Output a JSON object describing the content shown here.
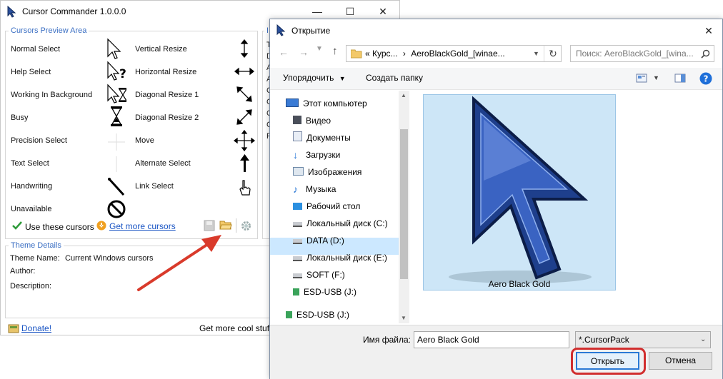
{
  "cursor_commander": {
    "title": "Cursor Commander 1.0.0.0",
    "preview_group": "Cursors Preview Area",
    "left_cursors": [
      "Normal Select",
      "Help Select",
      "Working In Background",
      "Busy",
      "Precision Select",
      "Text Select",
      "Handwriting",
      "Unavailable"
    ],
    "right_cursors": [
      "Vertical Resize",
      "Horizontal Resize",
      "Diagonal Resize 1",
      "Diagonal Resize 2",
      "Move",
      "Alternate Select",
      "Link Select"
    ],
    "use_cursors": "Use these cursors",
    "get_more": "Get more cursors",
    "theme_group": "Theme Details",
    "theme_name_label": "Theme Name:",
    "theme_name_value": "Current Windows cursors",
    "author_label": "Author:",
    "description_label": "Description:",
    "donate": "Donate!",
    "footer_text": "Get more cool stuf",
    "list_letters": [
      "T",
      "D",
      "A",
      "A",
      "C",
      "C",
      "G",
      "C",
      "R"
    ],
    "group2_letter": "I"
  },
  "dialog": {
    "title": "Открытие",
    "breadcrumb": [
      "«",
      "Курс...",
      "›",
      "AeroBlackGold_[winae..."
    ],
    "search_placeholder": "Поиск: AeroBlackGold_[wina...",
    "organize": "Упорядочить",
    "new_folder": "Создать папку",
    "tree": [
      "Этот компьютер",
      "Видео",
      "Документы",
      "Загрузки",
      "Изображения",
      "Музыка",
      "Рабочий стол",
      "Локальный диск (C:)",
      "DATA (D:)",
      "Локальный диск (E:)",
      "SOFT (F:)",
      "ESD-USB (J:)",
      "ESD-USB (J:)"
    ],
    "selected_tree": "DATA (D:)",
    "preview_caption": "Aero Black Gold",
    "filename_label": "Имя файла:",
    "filename_value": "Aero Black Gold",
    "filter": "*.CursorPack",
    "open": "Открыть",
    "cancel": "Отмена"
  },
  "colors": {
    "accent": "#3b6fc3",
    "selected": "#cce8ff",
    "preview_bg": "#cde6f7",
    "arrow": "#d93a2b",
    "highlight": "#d12e2e"
  }
}
